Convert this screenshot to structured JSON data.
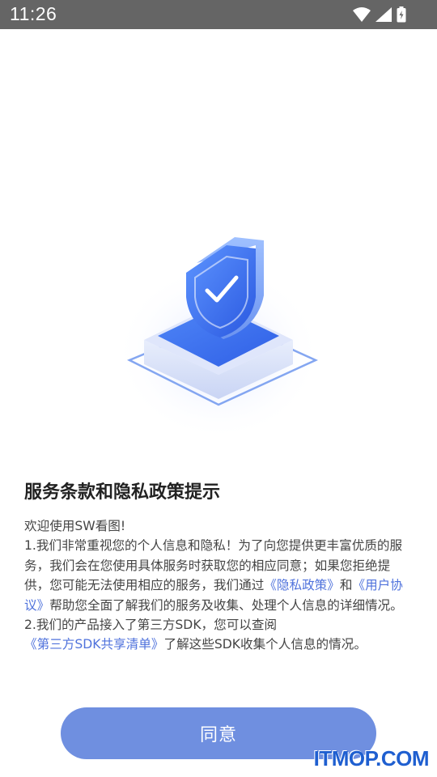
{
  "status_bar": {
    "time": "11:26",
    "icons": [
      "wifi-icon",
      "cellular-signal-icon",
      "battery-charging-icon"
    ]
  },
  "hero": {
    "icon": "shield-check-illustration"
  },
  "dialog": {
    "title": "服务条款和隐私政策提示",
    "intro": "欢迎使用SW看图!",
    "p1_text_a": "1.我们非常重视您的个人信息和隐私！为了向您提供更丰富优质的服务，我们会在您使用具体服务时获取您的相应同意；如果您拒绝提供，您可能无法使用相应的服务，我们通过",
    "privacy_link": "《隐私政策》",
    "p1_text_b": "和",
    "agreement_link": "《用户协议》",
    "p1_text_c": "帮助您全面了解我们的服务及收集、处理个人信息的详细情况。",
    "p2_text_a": "2.我们的产品接入了第三方SDK，您可以查阅",
    "sdk_link": "《第三方SDK共享清单》",
    "p2_text_b": "了解这些SDK收集个人信息的情况。",
    "agree_label": "同意"
  },
  "watermark": "ITMOP.COM",
  "colors": {
    "status_bar": "#656565",
    "link": "#4f72dc",
    "button": "#6f8fe0",
    "watermark": "#1f5fd0"
  }
}
